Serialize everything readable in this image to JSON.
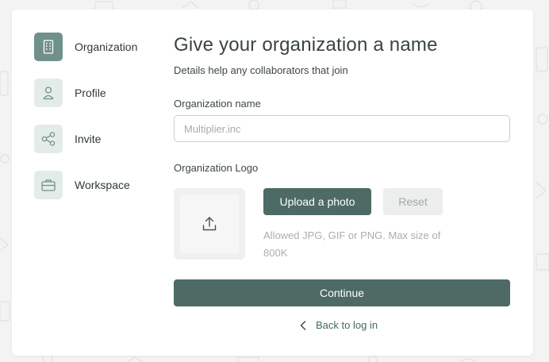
{
  "steps": [
    {
      "label": "Organization",
      "icon": "building-icon",
      "active": true
    },
    {
      "label": "Profile",
      "icon": "user-icon",
      "active": false
    },
    {
      "label": "Invite",
      "icon": "share-icon",
      "active": false
    },
    {
      "label": "Workspace",
      "icon": "briefcase-icon",
      "active": false
    }
  ],
  "main": {
    "title": "Give your organization a name",
    "subtitle": "Details help any collaborators that join",
    "org_name_label": "Organization name",
    "org_name_placeholder": "Multiplier.inc",
    "org_name_value": "",
    "logo_label": "Organization Logo",
    "upload_label": "Upload a photo",
    "reset_label": "Reset",
    "hint": "Allowed JPG, GIF or PNG. Max size of 800K",
    "continue_label": "Continue",
    "back_label": "Back to log in"
  },
  "colors": {
    "accent": "#4d6a64",
    "accent_light": "#e4ecea",
    "background": "#f2f3f2"
  }
}
